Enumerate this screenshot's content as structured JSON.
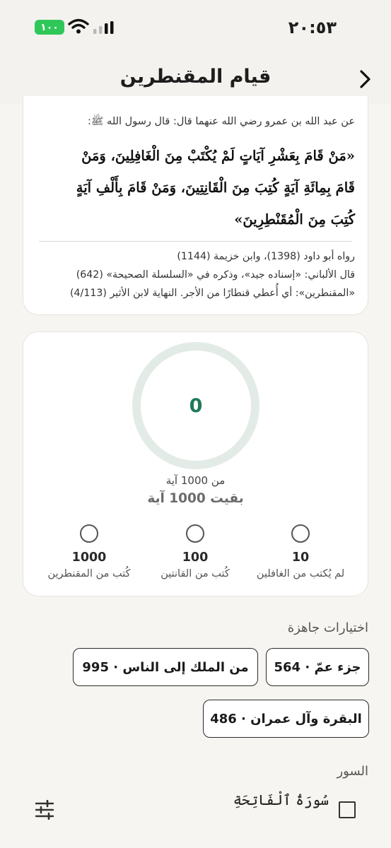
{
  "status_bar": {
    "time": "٢٠:٥٣",
    "battery": "١٠٠"
  },
  "header": {
    "title": "قيام المقنطرين"
  },
  "hadith": {
    "intro": "عن عبد الله بن عمرو رضي الله عنهما قال: قال رسول الله ﷺ:",
    "matn": [
      "«مَنْ قَامَ بِعَشْرِ آيَاتٍ لَمْ يُكْتَبْ مِنَ الْغَافِلِينَ، وَمَنْ",
      "قَامَ بِمِائَةِ آيَةٍ كُتِبَ مِنَ الْقَانِتِينَ، وَمَنْ قَامَ بِأَلْفِ آيَةٍ",
      "كُتِبَ مِنَ الْمُقَنْطِرِينَ»"
    ],
    "references": [
      "رواه أبو داود (1398)، وابن خزيمة (1144)",
      "قال الألباني: «إسناده جيد»، وذكره في «السلسلة الصحيحة» (642)",
      "«المقنطرين»: أي أُعطي قنطارًا من الأجر. النهاية لابن الأثير (4/113)"
    ]
  },
  "progress": {
    "current": "0",
    "total_label": "من 1000 آية",
    "remaining_label": "بقيت 1000 آية",
    "fraction": 0,
    "milestones": [
      {
        "number": "10",
        "label": "لم يُكتب من الغافلين"
      },
      {
        "number": "100",
        "label": "كُتب من القانتين"
      },
      {
        "number": "1000",
        "label": "كُتب من المقنطرين"
      }
    ]
  },
  "presets": {
    "title": "اختيارات جاهزة",
    "items": [
      {
        "label": "جزء عمّ · 564"
      },
      {
        "label": "من الملك إلى الناس · 995"
      },
      {
        "label": "البقرة وآل عمران · 486"
      }
    ]
  },
  "surahs": {
    "title": "السور",
    "items": [
      {
        "name": "سُورَةُ ٱلْفَاتِحَةِ"
      }
    ]
  },
  "colors": {
    "accent": "#1f7a57",
    "ring_track": "#e3ebe6",
    "battery": "#30c759",
    "background": "#f6f5f1"
  },
  "icons": {
    "back": "chevron-right-icon",
    "wifi": "wifi-icon",
    "signal": "signal-icon",
    "filter": "sliders-icon"
  }
}
